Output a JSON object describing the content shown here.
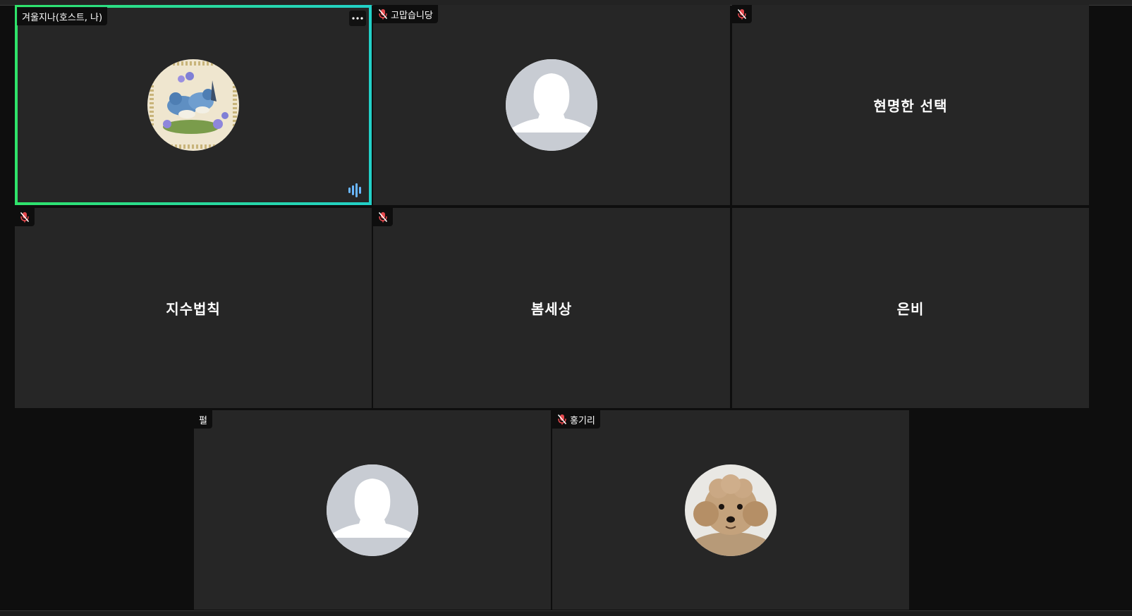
{
  "meeting": {
    "participants": [
      {
        "name": "겨울지나(호스트, 나)",
        "muted": false,
        "speaking": true,
        "avatar": "bird-artwork-photo"
      },
      {
        "name": "고맙습니당",
        "muted": true,
        "speaking": false,
        "avatar": "default-person-silhouette"
      },
      {
        "name": "현명한 선택",
        "muted": true,
        "speaking": false,
        "avatar": "none"
      },
      {
        "name": "지수법칙",
        "muted": true,
        "speaking": false,
        "avatar": "none"
      },
      {
        "name": "봄세상",
        "muted": true,
        "speaking": false,
        "avatar": "none"
      },
      {
        "name": "은비",
        "muted": false,
        "speaking": false,
        "avatar": "none"
      },
      {
        "name": "펄",
        "muted": false,
        "speaking": false,
        "avatar": "default-person-silhouette"
      },
      {
        "name": "홍기리",
        "muted": true,
        "speaking": false,
        "avatar": "poodle-dog-photo"
      }
    ]
  },
  "icons": {
    "muted_mic": "muted-microphone-icon",
    "more": "more-options-icon",
    "speaking": "audio-level-icon"
  },
  "colors": {
    "tile_bg": "#262626",
    "page_bg": "#0e0e0e",
    "active_border_start": "#2fe36a",
    "active_border_end": "#22d0c8",
    "muted_red": "#e5484d",
    "audio_blue": "#6ab7ff"
  }
}
